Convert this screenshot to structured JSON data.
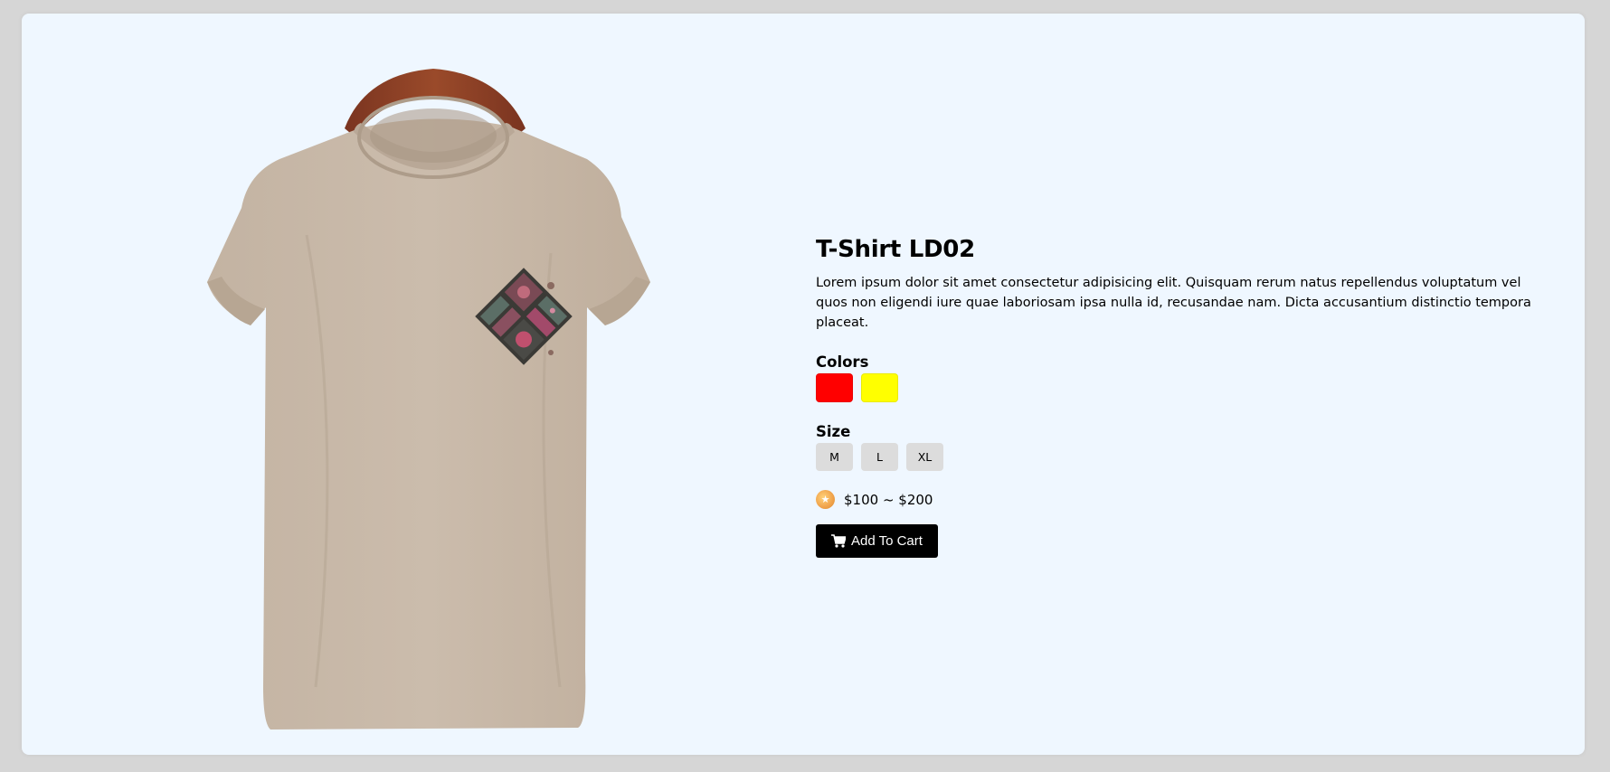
{
  "product": {
    "title": "T-Shirt LD02",
    "description": "Lorem ipsum dolor sit amet consectetur adipisicing elit. Quisquam rerum natus repellendus voluptatum vel quos non eligendi iure quae laboriosam ipsa nulla id, recusandae nam. Dicta accusantium distinctio tempora placeat.",
    "image_icon": "tshirt-on-hanger-image"
  },
  "colors": {
    "label": "Colors",
    "options": [
      {
        "name": "red",
        "hex": "#ff0000"
      },
      {
        "name": "yellow",
        "hex": "#ffff00"
      }
    ]
  },
  "sizes": {
    "label": "Size",
    "options": [
      "M",
      "L",
      "XL"
    ]
  },
  "price": {
    "icon": "coin-icon",
    "text": "$100 ~ $200"
  },
  "cart": {
    "icon": "cart-icon",
    "label": "Add To Cart"
  },
  "theme": {
    "card_background": "#eff7ff",
    "page_background": "#d6d6d6",
    "button_background": "#000000"
  }
}
